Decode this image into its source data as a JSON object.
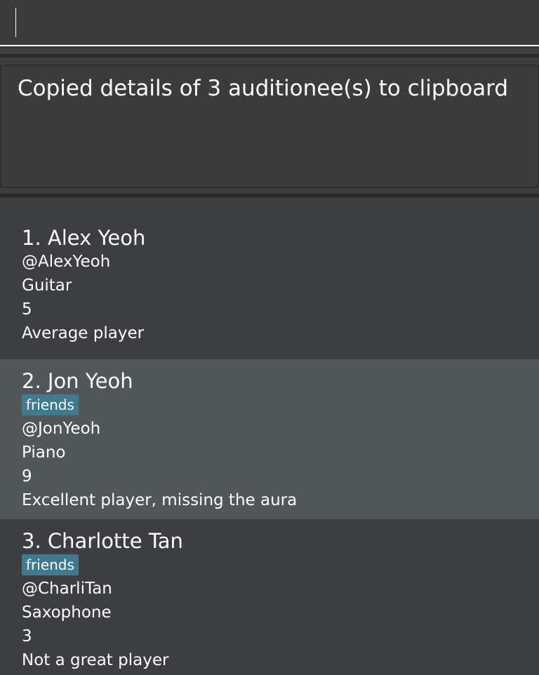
{
  "command": {
    "value": "",
    "placeholder": ""
  },
  "result": {
    "message": "Copied details of 3 auditionee(s) to clipboard"
  },
  "persons": [
    {
      "index": "1.",
      "name": "Alex Yeoh",
      "tags": [],
      "handle": "@AlexYeoh",
      "instrument": "Guitar",
      "rating": "5",
      "remark": "Average player"
    },
    {
      "index": "2.",
      "name": "Jon Yeoh",
      "tags": [
        "friends"
      ],
      "handle": "@JonYeoh",
      "instrument": "Piano",
      "rating": "9",
      "remark": "Excellent player, missing the aura"
    },
    {
      "index": "3.",
      "name": "Charlotte Tan",
      "tags": [
        "friends"
      ],
      "handle": "@CharliTan",
      "instrument": "Saxophone",
      "rating": "3",
      "remark": "Not a great player"
    }
  ],
  "colors": {
    "background": "#3c3e42",
    "selected_card": "#515658",
    "tag": "#3e7b91",
    "text": "#ffffff"
  }
}
